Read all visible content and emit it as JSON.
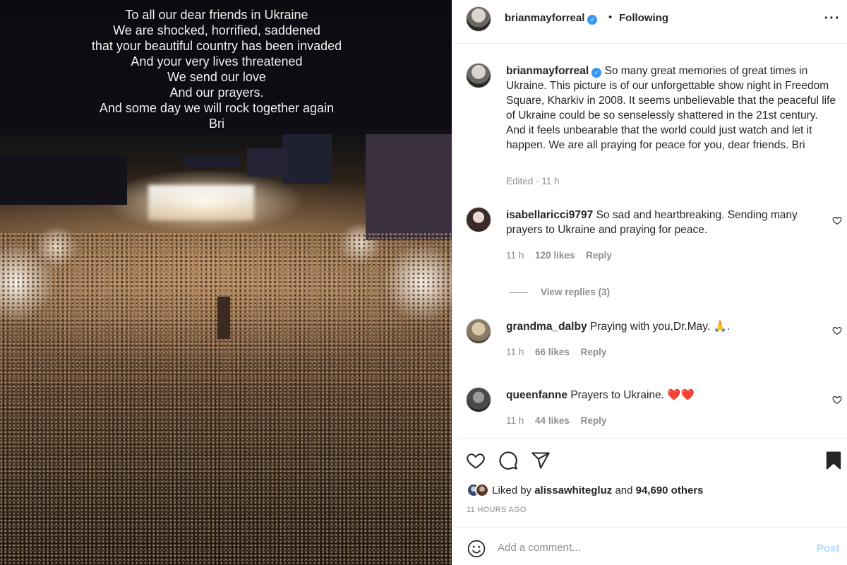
{
  "photo": {
    "overlay_lines": [
      "To all our dear friends in Ukraine",
      "We are shocked, horrified, saddened",
      "that your beautiful country has been invaded",
      "And your very lives threatened",
      "We send our love",
      "And our prayers.",
      "And some day we will rock together again",
      "Bri"
    ]
  },
  "header": {
    "username": "brianmayforreal",
    "verified_icon": "verified-badge-icon",
    "separator": "•",
    "follow_status": "Following",
    "more_icon": "more-options-icon"
  },
  "caption": {
    "username": "brianmayforreal",
    "text": "So many great memories of great times in Ukraine. This picture is of our unforgettable show night in Freedom Square, Kharkiv in 2008. It seems unbelievable that the peaceful life of Ukraine could be so senselessly shattered in the 21st century. And it feels unbearable that the world could just watch and let it happen. We are all praying for peace for you, dear friends. Bri",
    "edited": "Edited · 11 h"
  },
  "comments": [
    {
      "username": "isabellaricci9797",
      "text": "So sad and heartbreaking. Sending many prayers to Ukraine and praying for peace.",
      "time": "11 h",
      "likes": "120 likes",
      "reply": "Reply"
    },
    {
      "username": "grandma_dalby",
      "text": "Praying with you,Dr.May. 🙏.",
      "time": "11 h",
      "likes": "66 likes",
      "reply": "Reply"
    },
    {
      "username": "queenfanne",
      "text": "Prayers to Ukraine. ❤️❤️",
      "time": "11 h",
      "likes": "44 likes",
      "reply": "Reply"
    }
  ],
  "view_replies": "View replies (3)",
  "actions": {
    "icons": [
      "like-heart-icon",
      "comment-icon",
      "share-icon",
      "save-bookmark-icon"
    ],
    "liked_by_prefix": "Liked by",
    "liked_by_user": "alissawhitegluz",
    "liked_by_and": "and",
    "liked_by_others": "94,690 others",
    "time_ago": "11 HOURS AGO"
  },
  "comment_bar": {
    "emoji_icon": "emoji-icon",
    "placeholder": "Add a comment...",
    "post_label": "Post"
  },
  "colors": {
    "verified": "#3897f0",
    "muted": "#8e8e8e",
    "text": "#262626",
    "post_disabled": "#b3dbff"
  }
}
